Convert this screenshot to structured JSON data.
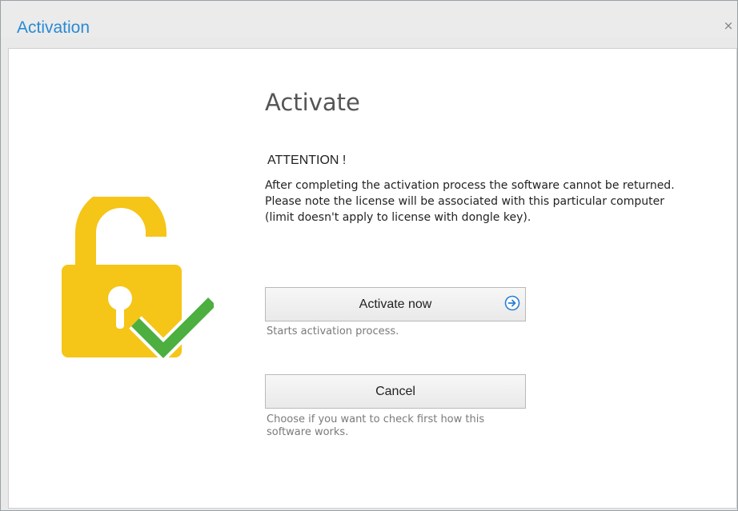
{
  "window": {
    "title": "Activation",
    "close_glyph": "×"
  },
  "icons": {
    "lock": "unlocked-padlock-icon",
    "check": "checkmark-icon",
    "arrow": "arrow-right-circle-icon"
  },
  "main": {
    "heading": "Activate",
    "attention": "ATTENTION !",
    "notice_lines": [
      "After completing the activation process the software cannot be returned.",
      "Please note the license will be associated with this particular computer",
      "(limit doesn't apply to license with dongle key)."
    ],
    "activate": {
      "label": "Activate now",
      "hint": "Starts activation process."
    },
    "cancel": {
      "label": "Cancel",
      "hint_lines": [
        "Choose if you want to check first how this",
        "software works."
      ]
    }
  },
  "colors": {
    "title": "#2a8ad4",
    "lock": "#f5c518",
    "check": "#4caf3f",
    "arrow": "#2a7fd4"
  }
}
